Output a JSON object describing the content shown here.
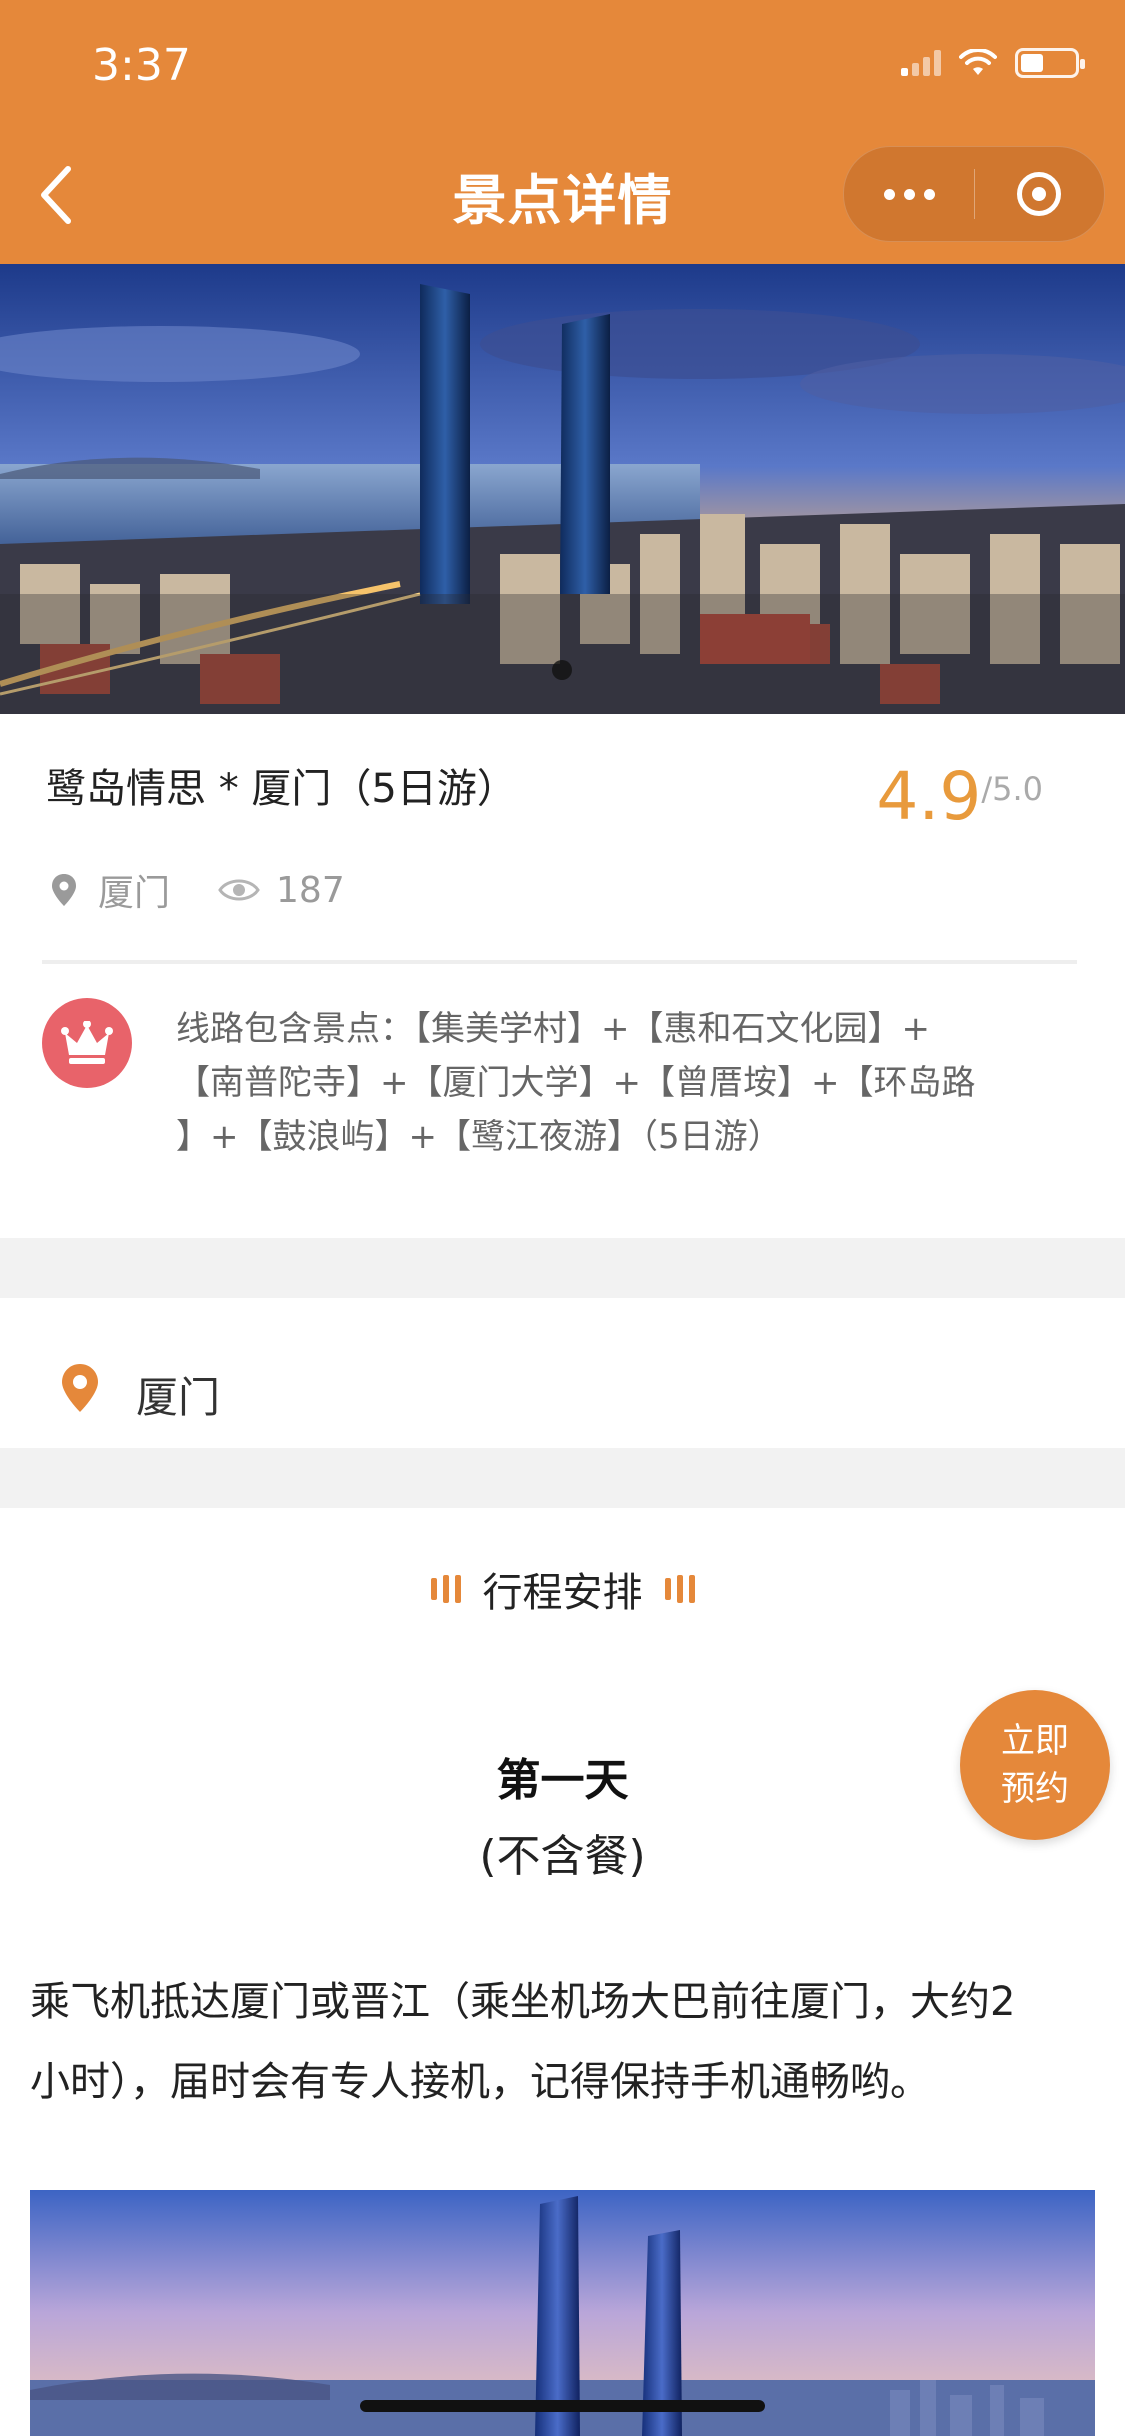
{
  "status_bar": {
    "time": "3:37"
  },
  "nav": {
    "title": "景点详情"
  },
  "colors": {
    "accent": "#E5883A",
    "rating": "#E89A3C",
    "crown_bg": "#E8636A"
  },
  "spot": {
    "title": "鹭岛情思 * 厦门（5日游）",
    "rating": "4.9",
    "rating_max": "/5.0",
    "location": "厦门",
    "views": "187"
  },
  "route": {
    "line1": "线路包含景点：【集美学村】+【惠和石文化园】+",
    "line2": "【南普陀寺】+【厦门大学】+【曾厝垵】+【环岛路",
    "line3": "】+【鼓浪屿】+【鹭江夜游】（5日游）"
  },
  "location_row": {
    "label": "厦门"
  },
  "itinerary": {
    "section_title": "行程安排",
    "day_title": "第一天",
    "day_meal": "(不含餐)",
    "day_desc_line1": "乘飞机抵达厦门或晋江（乘坐机场大巴前往厦门，大约2",
    "day_desc_line2": "小时），届时会有专人接机，记得保持手机通畅哟。"
  },
  "book_button": {
    "line1": "立即",
    "line2": "预约"
  },
  "icons": [
    "back-icon",
    "more-icon",
    "close-icon",
    "location-pin-icon",
    "eye-icon",
    "crown-icon",
    "section-decor-icon"
  ]
}
